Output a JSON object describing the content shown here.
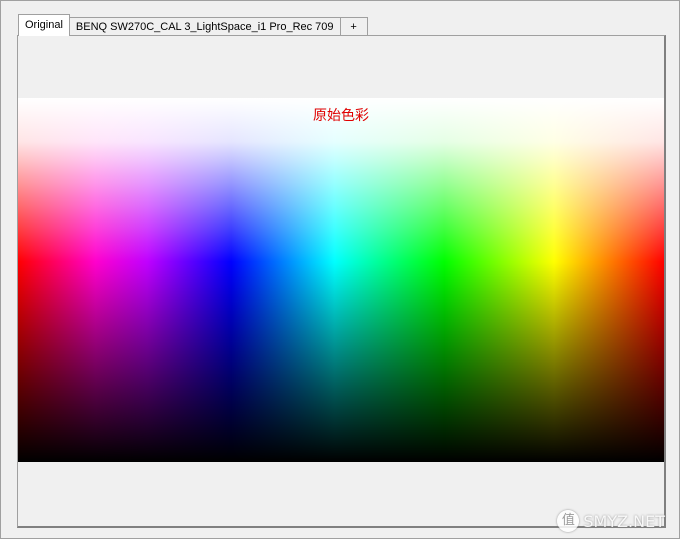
{
  "tabs": [
    {
      "label": "Original",
      "active": true
    },
    {
      "label": "BENQ SW270C_CAL 3_LightSpace_i1 Pro_Rec 709",
      "active": false
    },
    {
      "label": "+",
      "active": false
    }
  ],
  "canvas": {
    "title": "原始色彩"
  },
  "watermark": {
    "glyph": "值",
    "text": "SMYZ.NET"
  },
  "colors": {
    "title_red": "#e00000",
    "frame_gray": "#a0a0a0",
    "background": "#f0f0f0"
  }
}
